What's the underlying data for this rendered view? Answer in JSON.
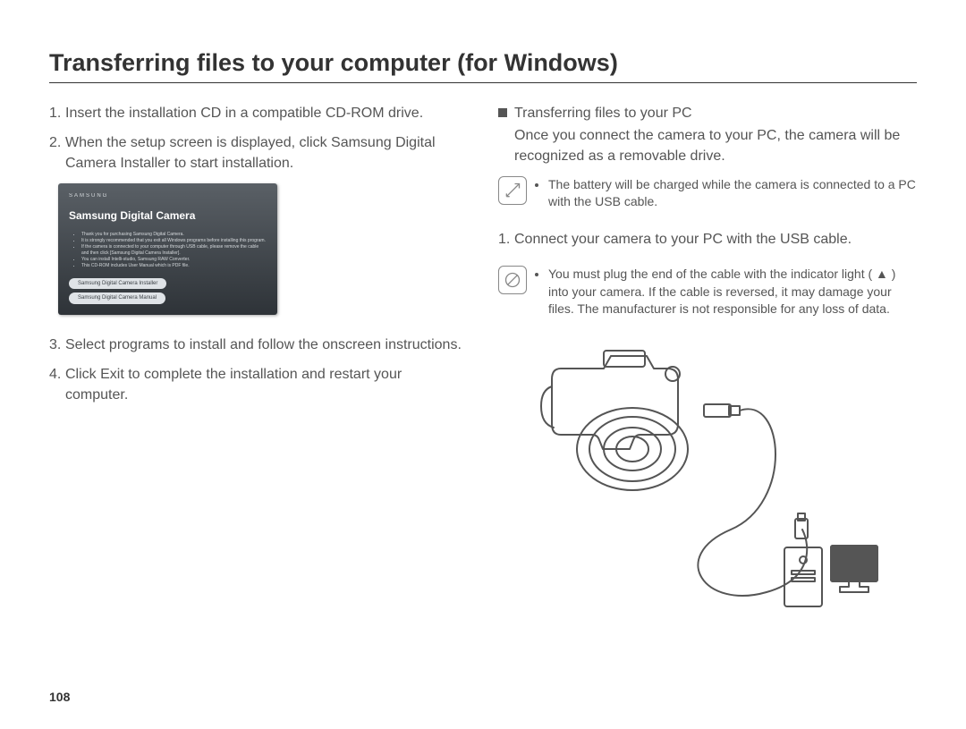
{
  "title": "Transferring files to your computer (for Windows)",
  "page_number": "108",
  "left": {
    "step1_num": "1.",
    "step1": "Insert the installation CD in a compatible CD-ROM drive.",
    "step2_num": "2.",
    "step2": "When the setup screen is displayed, click Samsung Digital Camera Installer to start installation.",
    "installer_brand": "SAMSUNG",
    "installer_title": "Samsung Digital Camera",
    "installer_line1": "Thank you for purchasing Samsung Digital Camera.",
    "installer_line2": "It is strongly recommended that you exit all Windows programs before installing this program.",
    "installer_line3": "If the camera is connected to your computer through USB cable, please remove the cable and then click [Samsung Digital Camera Installer].",
    "installer_line4": "You can install Intelli-studio, Samsung RAW Converter.",
    "installer_line5": "This CD-ROM includes User Manual which is PDF file.",
    "installer_btn1": "Samsung Digital Camera Installer",
    "installer_btn2": "Samsung Digital Camera Manual",
    "step3_num": "3.",
    "step3": "Select programs to install and follow the onscreen instructions.",
    "step4_num": "4.",
    "step4": "Click Exit to complete the installation and restart your computer."
  },
  "right": {
    "subhead": "Transferring files to your PC",
    "sub_desc": "Once you connect the camera to your PC, the camera will be recognized as a removable drive.",
    "note1": "The battery will be charged while the camera is connected to a PC with the USB cable.",
    "rstep1_num": "1.",
    "rstep1": "Connect your camera to your PC with the USB cable.",
    "note2": "You must plug the end of the cable with the indicator light ( ▲ ) into your camera. If the cable is reversed, it may damage your files. The manufacturer is not responsible for any loss of data."
  }
}
